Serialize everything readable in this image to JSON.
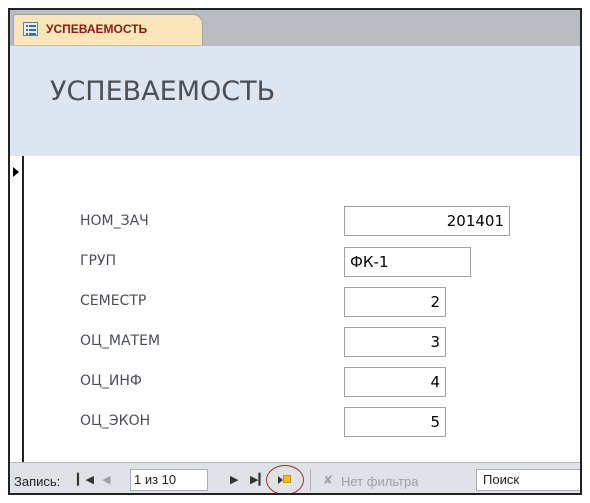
{
  "tab": {
    "label": "УСПЕВАЕМОСТЬ",
    "icon": "form-icon"
  },
  "form": {
    "title": "УСПЕВАЕМОСТЬ",
    "fields": [
      {
        "label": "НОМ_ЗАЧ",
        "value": "201401"
      },
      {
        "label": "ГРУП",
        "value": "ФК-1"
      },
      {
        "label": "СЕМЕСТР",
        "value": "2"
      },
      {
        "label": "ОЦ_МАТЕМ",
        "value": "3"
      },
      {
        "label": "ОЦ_ИНФ",
        "value": "4"
      },
      {
        "label": "ОЦ_ЭКОН",
        "value": "5"
      }
    ]
  },
  "nav": {
    "label": "Запись:",
    "current": "1 из 10",
    "first_icon": "first-record-icon",
    "prev_icon": "previous-record-icon",
    "next_icon": "next-record-icon",
    "last_icon": "last-record-icon",
    "new_icon": "new-record-icon",
    "filter_icon": "no-filter-icon",
    "filter_label": "Нет фильтра",
    "search_placeholder": "Поиск"
  },
  "colors": {
    "tab_bg": "#fbe6b9",
    "tab_text": "#8a1c13",
    "header_bg": "#dde5f0",
    "highlight_circle": "#b0282a"
  }
}
